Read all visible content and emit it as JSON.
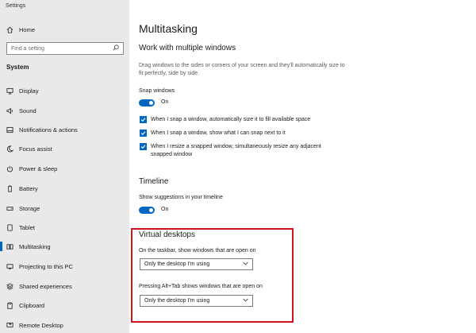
{
  "app": {
    "title": "Settings"
  },
  "sidebar": {
    "home_label": "Home",
    "search_placeholder": "Find a setting",
    "section": "System",
    "items": [
      {
        "label": "Display",
        "icon": "monitor-icon"
      },
      {
        "label": "Sound",
        "icon": "speaker-icon"
      },
      {
        "label": "Notifications & actions",
        "icon": "notification-icon"
      },
      {
        "label": "Focus assist",
        "icon": "moon-icon"
      },
      {
        "label": "Power & sleep",
        "icon": "power-icon"
      },
      {
        "label": "Battery",
        "icon": "battery-icon"
      },
      {
        "label": "Storage",
        "icon": "storage-icon"
      },
      {
        "label": "Tablet",
        "icon": "tablet-icon"
      },
      {
        "label": "Multitasking",
        "icon": "multitasking-icon",
        "selected": true
      },
      {
        "label": "Projecting to this PC",
        "icon": "projector-icon"
      },
      {
        "label": "Shared experiences",
        "icon": "shared-icon"
      },
      {
        "label": "Clipboard",
        "icon": "clipboard-icon"
      },
      {
        "label": "Remote Desktop",
        "icon": "remote-desktop-icon"
      }
    ]
  },
  "main": {
    "page_title": "Multitasking",
    "windows": {
      "heading": "Work with multiple windows",
      "description": "Drag windows to the sides or corners of your screen and they'll automatically size to fit perfectly, side by side.",
      "snap_label": "Snap windows",
      "snap_state": "On",
      "checkboxes": [
        "When I snap a window, automatically size it to fill available space",
        "When I snap a window, show what I can snap next to it",
        "When I resize a snapped window, simultaneously resize any adjacent snapped window"
      ]
    },
    "timeline": {
      "heading": "Timeline",
      "suggestions_label": "Show suggestions in your timeline",
      "suggestions_state": "On"
    },
    "virtual_desktops": {
      "heading": "Virtual desktops",
      "taskbar_label": "On the taskbar, show windows that are open on",
      "taskbar_value": "Only the desktop I'm using",
      "alttab_label": "Pressing Alt+Tab shows windows that are open on",
      "alttab_value": "Only the desktop I'm using"
    }
  },
  "colors": {
    "accent": "#0067c0",
    "highlight": "#d0121c",
    "sidebar_bg": "#e9e9e9"
  }
}
